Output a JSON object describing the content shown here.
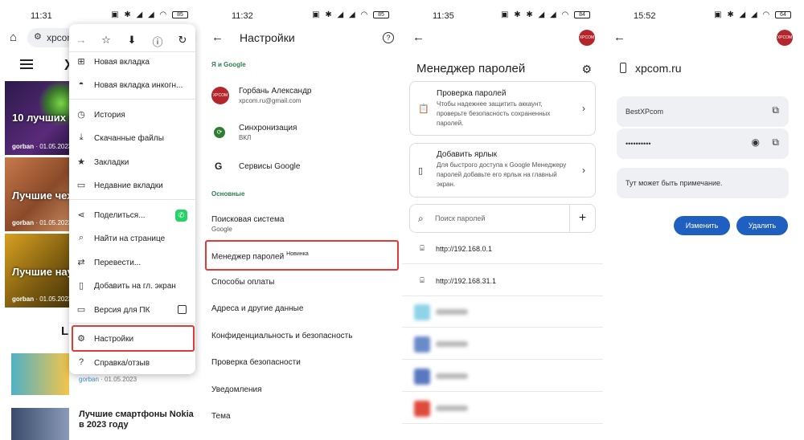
{
  "panel1": {
    "status": {
      "time": "11:31"
    },
    "url": "xpcom",
    "menu": {
      "items": [
        {
          "label": "Новая вкладка"
        },
        {
          "label": "Новая вкладка инкогн..."
        },
        {
          "label": "История"
        },
        {
          "label": "Скачанные файлы"
        },
        {
          "label": "Закладки"
        },
        {
          "label": "Недавние вкладки"
        },
        {
          "label": "Поделиться..."
        },
        {
          "label": "Найти на странице"
        },
        {
          "label": "Перевести..."
        },
        {
          "label": "Добавить на гл. экран"
        },
        {
          "label": "Версия для ПК"
        },
        {
          "label": "Настройки"
        },
        {
          "label": "Справка/отзыв"
        }
      ]
    },
    "page": {
      "logo": "X",
      "cards": [
        {
          "title": "10 лучших и Survivors дл",
          "author": "gorban",
          "date": "01.05.2023"
        },
        {
          "title": "Лучшие чех году",
          "author": "gorban",
          "date": "01.05.2023"
        },
        {
          "title": "Лучшие нау году",
          "author": "gorban",
          "date": "01.05.2023"
        }
      ],
      "section_fragment": "L",
      "list": [
        {
          "author": "gorban",
          "date": "01.05.2023",
          "title": ""
        },
        {
          "author": "",
          "date": "",
          "title": "Лучшие смартфоны Nokia в 2023 году"
        }
      ]
    }
  },
  "panel2": {
    "status": {
      "time": "11:32"
    },
    "title": "Настройки",
    "section1": "Я и Google",
    "account_name": "Горбань Александр",
    "account_email": "xpcom.ru@gmail.com",
    "sync_label": "Синхронизация",
    "sync_value": "ВКЛ",
    "google_services": "Сервисы Google",
    "section2": "Основные",
    "search_engine": "Поисковая система",
    "search_engine_value": "Google",
    "password_manager": "Менеджер паролей",
    "new_badge": "Новинка",
    "payment_methods": "Способы оплаты",
    "addresses": "Адреса и другие данные",
    "privacy": "Конфиденциальность и безопасность",
    "safety_check": "Проверка безопасности",
    "notifications": "Уведомления",
    "theme": "Тема"
  },
  "panel3": {
    "status": {
      "time": "11:35"
    },
    "title": "Менеджер паролей",
    "check_title": "Проверка паролей",
    "check_desc": "Чтобы надежнее защитить аккаунт, проверьте безопасность сохраненных паролей.",
    "shortcut_title": "Добавить ярлык",
    "shortcut_desc": "Для быстрого доступа к Google Менеджеру паролей добавьте его ярлык на главный экран.",
    "search_placeholder": "Поиск паролей",
    "entries": [
      "http://192.168.0.1",
      "http://192.168.31.1"
    ]
  },
  "panel4": {
    "status": {
      "time": "15:52"
    },
    "site": "xpcom.ru",
    "username": "BestXPcom",
    "password_mask": "••••••••••",
    "note": "Тут может быть примечание.",
    "edit_label": "Изменить",
    "delete_label": "Удалить"
  },
  "colors": {
    "highlight": "#e53935",
    "accent": "#1f5fbf",
    "section_green": "#2e7d4f"
  }
}
